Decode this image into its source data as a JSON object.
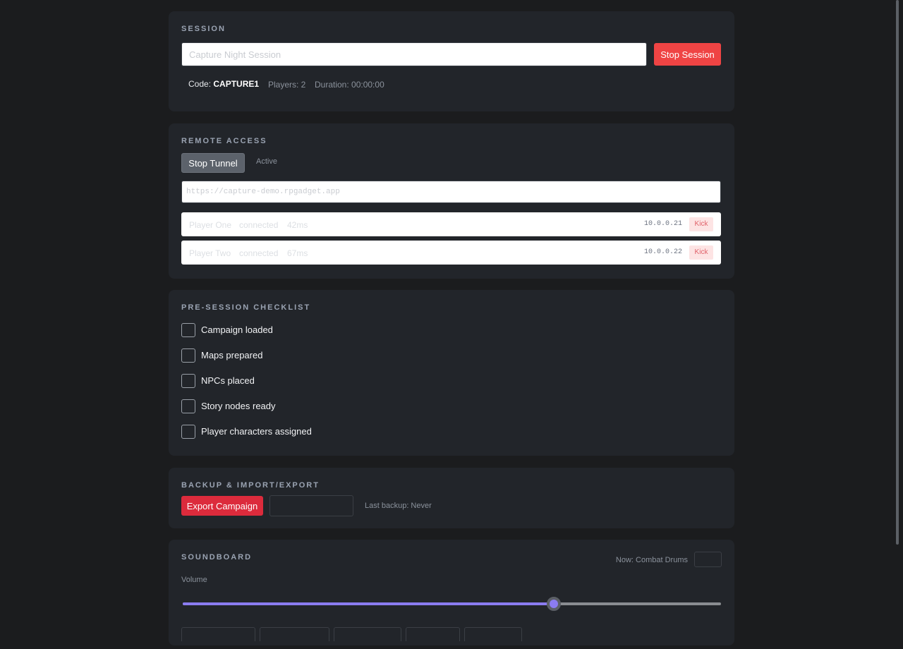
{
  "session": {
    "title": "SESSION",
    "name_placeholder": "Capture Night Session",
    "stop_label": "Stop Session",
    "code_label": "Code: ",
    "code_value": "CAPTURE1",
    "players": "Players: 2",
    "duration": "Duration: 00:00:00"
  },
  "remote": {
    "title": "REMOTE ACCESS",
    "stop_tunnel_label": "Stop Tunnel",
    "status": "Active",
    "url_placeholder": "https://capture-demo.rpgadget.app",
    "players": [
      {
        "name": "Player One",
        "status": "connected",
        "ping": "42ms",
        "ip": "10.0.0.21",
        "kick_label": "Kick"
      },
      {
        "name": "Player Two",
        "status": "connected",
        "ping": "67ms",
        "ip": "10.0.0.22",
        "kick_label": "Kick"
      }
    ]
  },
  "checklist": {
    "title": "PRE-SESSION CHECKLIST",
    "items": [
      {
        "label": "Campaign loaded",
        "checked": false
      },
      {
        "label": "Maps prepared",
        "checked": false
      },
      {
        "label": "NPCs placed",
        "checked": false
      },
      {
        "label": "Story nodes ready",
        "checked": false
      },
      {
        "label": "Player characters assigned",
        "checked": false
      }
    ]
  },
  "backup": {
    "title": "BACKUP & IMPORT/EXPORT",
    "export_label": "Export Campaign",
    "last_backup": "Last backup: Never"
  },
  "soundboard": {
    "title": "SOUNDBOARD",
    "now_playing": "Now: Combat Drums",
    "volume_label": "Volume",
    "volume_fraction": 0.69
  },
  "colors": {
    "accent_red": "#ef4444",
    "export_red": "#dc2b3c",
    "slider_purple": "#8b7cf0",
    "panel_bg": "#22252a",
    "page_bg": "#1b1c1e"
  }
}
